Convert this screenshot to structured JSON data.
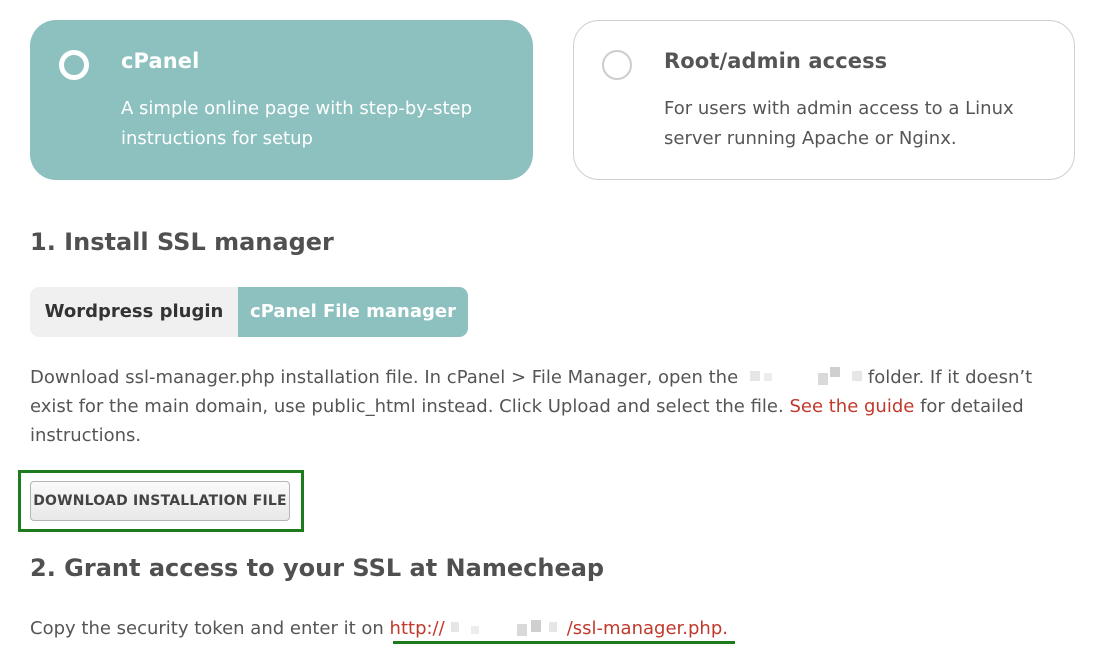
{
  "options": {
    "cpanel": {
      "title": "cPanel",
      "description": "A simple online page with step-by-step instructions for setup"
    },
    "root": {
      "title": "Root/admin access",
      "description": "For users with admin access to a Linux server running Apache or Nginx."
    }
  },
  "step1": {
    "heading": "1. Install SSL manager",
    "tabs": {
      "wordpress": "Wordpress plugin",
      "file_manager": "cPanel File manager"
    },
    "text_before": "Download ssl-manager.php installation file. In cPanel > File Manager, open the ",
    "text_middle": "folder. If it doesn’t exist for the main domain, use public_html instead. Click Upload and select the file. ",
    "guide_link": "See the guide",
    "text_after": " for detailed instructions.",
    "download_button": "DOWNLOAD INSTALLATION FILE"
  },
  "step2": {
    "heading": "2. Grant access to your SSL at Namecheap",
    "text_before": "Copy the security token and enter it on ",
    "url_prefix": "http://",
    "url_suffix": "/ssl-manager.php."
  },
  "colors": {
    "accent": "#8cc1bf",
    "link": "#c0392b",
    "highlight": "#1d7a1d"
  }
}
